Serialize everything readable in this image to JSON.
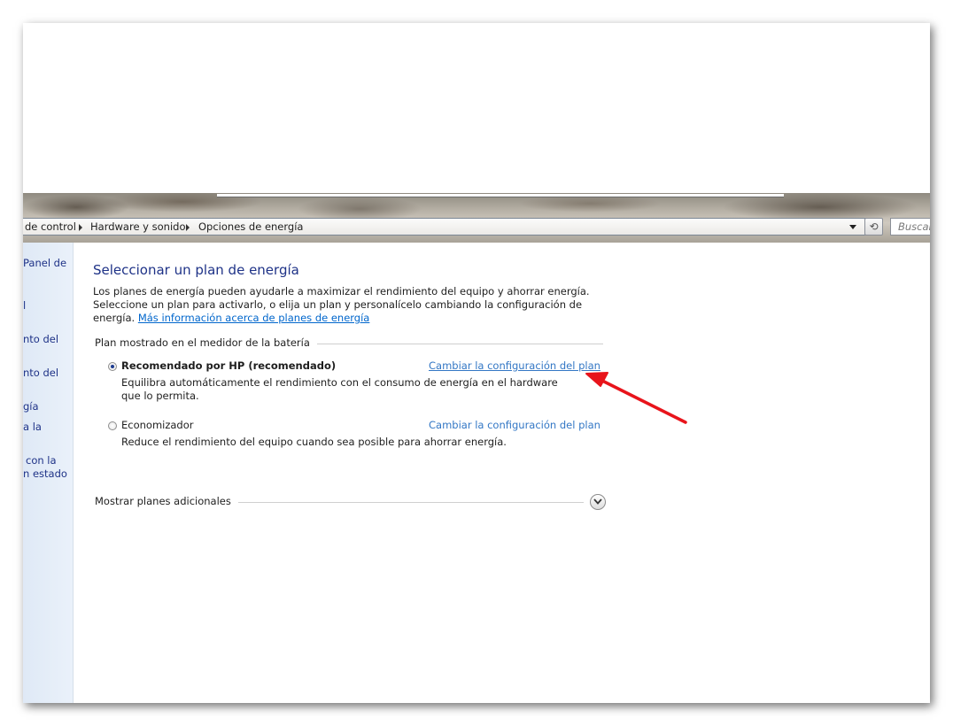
{
  "breadcrumb": {
    "items": [
      "de control",
      "Hardware y sonido",
      "Opciones de energía"
    ]
  },
  "search": {
    "placeholder": "Buscar"
  },
  "sidebar": {
    "items": [
      "Panel de",
      "l",
      "nto del",
      "nto del",
      "gía",
      "a la",
      "con la",
      "n estado"
    ]
  },
  "main": {
    "title": "Seleccionar un plan de energía",
    "intro_text": "Los planes de energía pueden ayudarle a maximizar el rendimiento del equipo y ahorrar energía. Seleccione un plan para activarlo, o elija un plan y personalícelo cambiando la configuración de energía.",
    "intro_link": "Más información acerca de planes de energía",
    "section_label": "Plan mostrado en el medidor de la batería",
    "plans": [
      {
        "name": "Recomendado por HP (recomendado)",
        "selected": true,
        "description": "Equilibra automáticamente el rendimiento con el consumo de energía en el hardware que lo permita.",
        "link": "Cambiar la configuración del plan"
      },
      {
        "name": "Economizador",
        "selected": false,
        "description": "Reduce el rendimiento del equipo cuando sea posible para ahorrar energía.",
        "link": "Cambiar la configuración del plan"
      }
    ],
    "more_plans_label": "Mostrar planes adicionales"
  },
  "colors": {
    "title": "#1e3287",
    "link": "#0066cc",
    "annotation_arrow": "#e8141b",
    "sidebar": "#dfe9f6"
  }
}
